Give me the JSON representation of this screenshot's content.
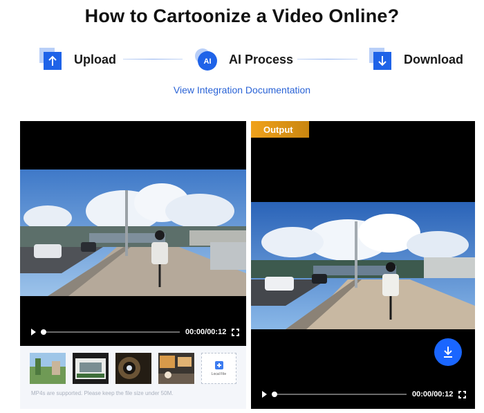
{
  "page": {
    "title": "How to Cartoonize a Video Online?",
    "doc_link": "View Integration Documentation"
  },
  "steps": [
    {
      "label": "Upload",
      "icon": "upload-icon"
    },
    {
      "label": "AI Process",
      "icon": "ai-icon",
      "icon_text": "AI"
    },
    {
      "label": "Download",
      "icon": "download-icon"
    }
  ],
  "input_player": {
    "time": "00:00/00:12",
    "progress": 0
  },
  "thumbnails": [
    {
      "name": "sample-video-park"
    },
    {
      "name": "sample-video-bus"
    },
    {
      "name": "sample-video-tunnel"
    },
    {
      "name": "sample-video-street"
    }
  ],
  "local_file": {
    "label": "Local File"
  },
  "upload_hint": "MP4s are supported. Please keep the file size under 50M.",
  "output": {
    "badge": "Output",
    "time": "00:00/00:12",
    "progress": 0
  },
  "colors": {
    "accent_blue": "#1a66ff",
    "link_blue": "#2a63d6",
    "output_badge": "#e89a18",
    "panel_bg": "#f4f6fa"
  }
}
